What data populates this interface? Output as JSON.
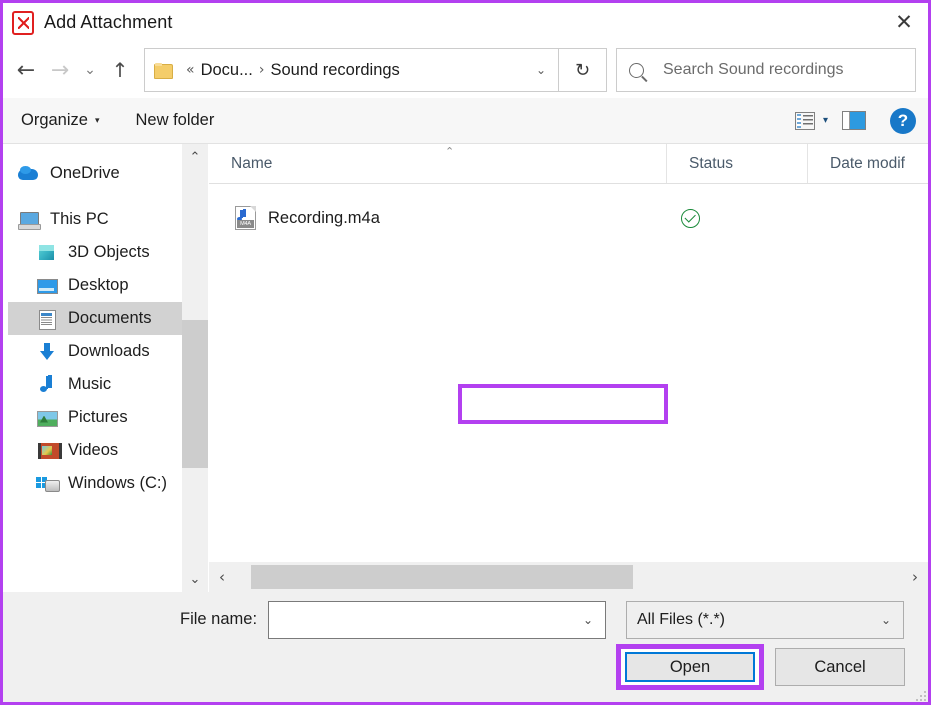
{
  "window": {
    "title": "Add Attachment",
    "app_icon": "pdf-file-icon",
    "close_label": "✕",
    "border_color": "#b340f0"
  },
  "nav": {
    "back": "←",
    "forward": "→",
    "recent": "⌄",
    "up": "↑",
    "refresh": "↻",
    "breadcrumb": {
      "folder_icon": "folder-icon",
      "overflow": "«",
      "parent": "Docu...",
      "separator": "›",
      "current": "Sound recordings",
      "caret": "⌄"
    },
    "search": {
      "icon": "search-icon",
      "placeholder": "Search Sound recordings",
      "value": ""
    }
  },
  "toolbar": {
    "organize_label": "Organize",
    "organize_caret": "▾",
    "new_folder_label": "New folder",
    "view_icon": "list-view-icon",
    "view_caret": "▾",
    "pane_icon": "preview-pane-icon",
    "help_label": "?"
  },
  "sidebar": {
    "items": [
      {
        "label": "OneDrive",
        "icon": "onedrive-icon",
        "level": "root",
        "selected": false
      },
      {
        "label": "This PC",
        "icon": "this-pc-icon",
        "level": "root",
        "selected": false
      },
      {
        "label": "3D Objects",
        "icon": "3d-objects-icon",
        "level": "l1",
        "selected": false
      },
      {
        "label": "Desktop",
        "icon": "desktop-icon",
        "level": "l1",
        "selected": false
      },
      {
        "label": "Documents",
        "icon": "documents-icon",
        "level": "l1",
        "selected": true
      },
      {
        "label": "Downloads",
        "icon": "downloads-icon",
        "level": "l1",
        "selected": false
      },
      {
        "label": "Music",
        "icon": "music-icon",
        "level": "l1",
        "selected": false
      },
      {
        "label": "Pictures",
        "icon": "pictures-icon",
        "level": "l1",
        "selected": false
      },
      {
        "label": "Videos",
        "icon": "videos-icon",
        "level": "l1",
        "selected": false
      },
      {
        "label": "Windows (C:)",
        "icon": "windows-drive-icon",
        "level": "l1",
        "selected": false
      }
    ],
    "scroll_up": "⌃",
    "scroll_down": "⌄"
  },
  "filelist": {
    "columns": [
      {
        "label": "Name"
      },
      {
        "label": "Status"
      },
      {
        "label": "Date modif"
      }
    ],
    "sort_indicator": "⌃",
    "rows": [
      {
        "name": "Recording.m4a",
        "icon": "m4a-file-icon",
        "icon_label": "M4A",
        "status": "synced-check-icon",
        "date_modified": "",
        "annotated": true
      }
    ],
    "hscroll": {
      "left": "‹",
      "right": "›"
    }
  },
  "footer": {
    "filename_label": "File name:",
    "filename_value": "",
    "filename_placeholder": "",
    "filename_caret": "⌄",
    "filter_value": "All Files (*.*)",
    "filter_caret": "⌄",
    "open_label": "Open",
    "cancel_label": "Cancel"
  },
  "annotations": {
    "highlight_color": "#b340f0",
    "focus_color": "#0078d7"
  }
}
